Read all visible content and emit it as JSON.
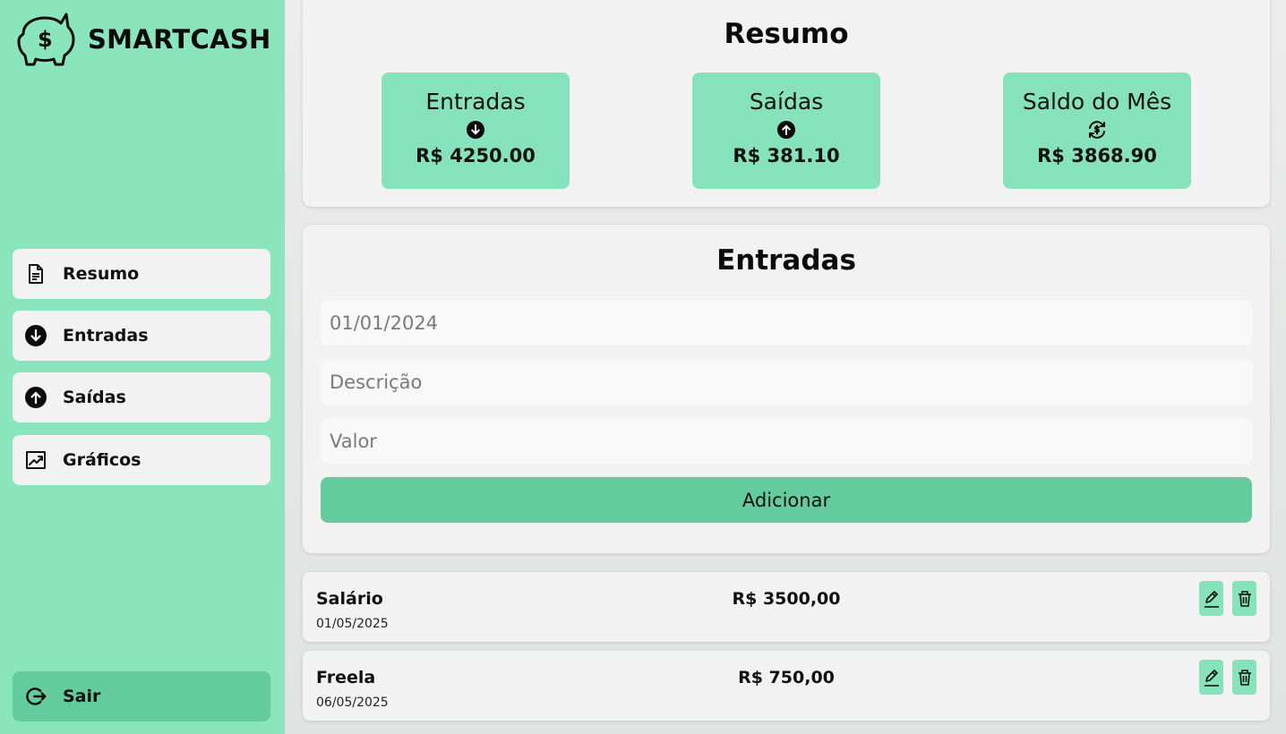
{
  "app": {
    "name": "SMARTCASH"
  },
  "sidebar": {
    "items": [
      {
        "label": "Resumo",
        "icon": "document-icon"
      },
      {
        "label": "Entradas",
        "icon": "arrow-down-circle-icon"
      },
      {
        "label": "Saídas",
        "icon": "arrow-up-circle-icon"
      },
      {
        "label": "Gráficos",
        "icon": "chart-line-icon"
      }
    ],
    "logout": {
      "label": "Sair",
      "icon": "logout-icon"
    }
  },
  "resumo": {
    "title": "Resumo",
    "cards": [
      {
        "label": "Entradas",
        "value": "R$ 4250.00",
        "icon": "arrow-down-circle-icon"
      },
      {
        "label": "Saídas",
        "value": "R$ 381.10",
        "icon": "arrow-up-circle-icon"
      },
      {
        "label": "Saldo do Mês",
        "value": "R$ 3868.90",
        "icon": "money-cycle-icon"
      }
    ]
  },
  "entradas": {
    "title": "Entradas",
    "date_placeholder": "01/01/2024",
    "desc_placeholder": "Descrição",
    "value_placeholder": "Valor",
    "add_label": "Adicionar"
  },
  "transactions": [
    {
      "description": "Salário",
      "date": "01/05/2025",
      "value": "R$ 3500,00"
    },
    {
      "description": "Freela",
      "date": "06/05/2025",
      "value": "R$ 750,00"
    }
  ],
  "colors": {
    "sidebar": "#8ae4bc",
    "accent": "#64cb9e",
    "card": "#86e2ba",
    "panel": "#f2f2f2"
  }
}
